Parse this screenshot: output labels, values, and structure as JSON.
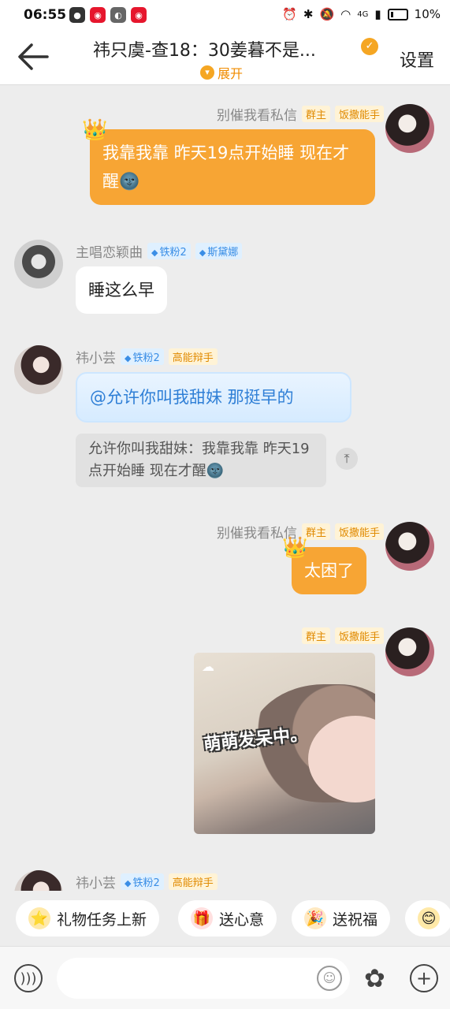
{
  "status_bar": {
    "time": "06:55",
    "network": "4G",
    "battery": "10%"
  },
  "header": {
    "title": "祎只虞-查18：30姜暮不是...",
    "expand_label": "展开",
    "settings_label": "设置"
  },
  "messages": [
    {
      "sender": "别催我看私信",
      "tags": [
        "群主",
        "饭撒能手"
      ],
      "side": "right",
      "text": "我靠我靠 昨天19点开始睡 现在才醒🌚"
    },
    {
      "sender": "主唱恋颖曲",
      "tags": [
        "铁粉2",
        "斯黛娜"
      ],
      "side": "left",
      "text": "睡这么早"
    },
    {
      "sender": "祎小芸",
      "tags": [
        "铁粉2",
        "高能辩手"
      ],
      "side": "left",
      "text": "@允许你叫我甜妹 那挺早的",
      "quote": "允许你叫我甜妹：我靠我靠 昨天19点开始睡 现在才醒🌚"
    },
    {
      "sender": "别催我看私信",
      "tags": [
        "群主",
        "饭撒能手"
      ],
      "side": "right",
      "text": "太困了"
    },
    {
      "sender": "",
      "tags": [
        "群主",
        "饭撒能手"
      ],
      "side": "right",
      "image_caption": "萌萌发呆中。"
    },
    {
      "sender": "祎小芸",
      "tags": [
        "铁粉2",
        "高能辩手"
      ],
      "side": "left"
    }
  ],
  "chips": [
    {
      "label": "礼物任务上新",
      "icon": "star-icon"
    },
    {
      "label": "送心意",
      "icon": "gift-icon"
    },
    {
      "label": "送祝福",
      "icon": "blessing-icon"
    }
  ],
  "input": {
    "placeholder": ""
  },
  "colors": {
    "accent": "#f7a534",
    "quote_bg": "#e1e1e1"
  }
}
